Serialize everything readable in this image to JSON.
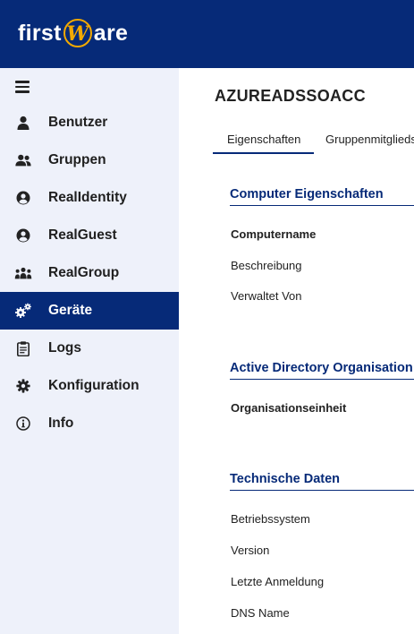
{
  "header": {
    "logo_prefix": "first",
    "logo_suffix": "are",
    "logo_mark": "W",
    "brand_color": "#062a78",
    "accent_color": "#f2a900"
  },
  "sidebar": {
    "menu_icon": "hamburger-menu-icon",
    "items": [
      {
        "label": "Benutzer",
        "icon": "user-icon",
        "active": false
      },
      {
        "label": "Gruppen",
        "icon": "group-icon",
        "active": false
      },
      {
        "label": "RealIdentity",
        "icon": "user-circle-icon",
        "active": false
      },
      {
        "label": "RealGuest",
        "icon": "user-circle-icon",
        "active": false
      },
      {
        "label": "RealGroup",
        "icon": "people-group-icon",
        "active": false
      },
      {
        "label": "Geräte",
        "icon": "cogs-icon",
        "active": true
      },
      {
        "label": "Logs",
        "icon": "clipboard-icon",
        "active": false
      },
      {
        "label": "Konfiguration",
        "icon": "gear-icon",
        "active": false
      },
      {
        "label": "Info",
        "icon": "info-icon",
        "active": false
      }
    ]
  },
  "main": {
    "title": "AZUREADSSOACC",
    "tabs": [
      {
        "label": "Eigenschaften",
        "active": true
      },
      {
        "label": "Gruppenmitgliedschaften",
        "active": false
      }
    ],
    "sections": [
      {
        "title": "Computer Eigenschaften",
        "fields": [
          {
            "label": "Computername",
            "bold": true
          },
          {
            "label": "Beschreibung",
            "bold": false
          },
          {
            "label": "Verwaltet Von",
            "bold": false
          }
        ]
      },
      {
        "title": "Active Directory Organisation",
        "fields": [
          {
            "label": "Organisationseinheit",
            "bold": true
          }
        ]
      },
      {
        "title": "Technische Daten",
        "fields": [
          {
            "label": "Betriebssystem",
            "bold": false
          },
          {
            "label": "Version",
            "bold": false
          },
          {
            "label": "Letzte Anmeldung",
            "bold": false
          },
          {
            "label": "DNS Name",
            "bold": false
          }
        ]
      }
    ]
  }
}
